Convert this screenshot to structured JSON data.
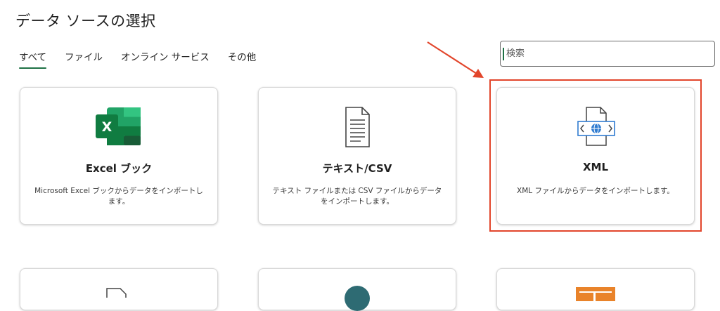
{
  "dialog": {
    "title": "データ ソースの選択"
  },
  "tabs": [
    {
      "label": "すべて",
      "active": true
    },
    {
      "label": "ファイル",
      "active": false
    },
    {
      "label": "オンライン サービス",
      "active": false
    },
    {
      "label": "その他",
      "active": false
    }
  ],
  "search": {
    "placeholder": "検索",
    "value": ""
  },
  "cards": [
    {
      "name": "Excel ブック",
      "description": "Microsoft Excel ブックからデータをインポートします。",
      "icon": "excel-icon"
    },
    {
      "name": "テキスト/CSV",
      "description": "テキスト ファイルまたは CSV ファイルからデータをインポートします。",
      "icon": "text-file-icon"
    },
    {
      "name": "XML",
      "description": "XML ファイルからデータをインポートします。",
      "icon": "xml-file-icon"
    }
  ],
  "annotation": {
    "highlight_color": "#e2452b",
    "arrow_color": "#e2452b"
  },
  "colors": {
    "accent": "#1e7145",
    "excel_green": "#21a366"
  }
}
